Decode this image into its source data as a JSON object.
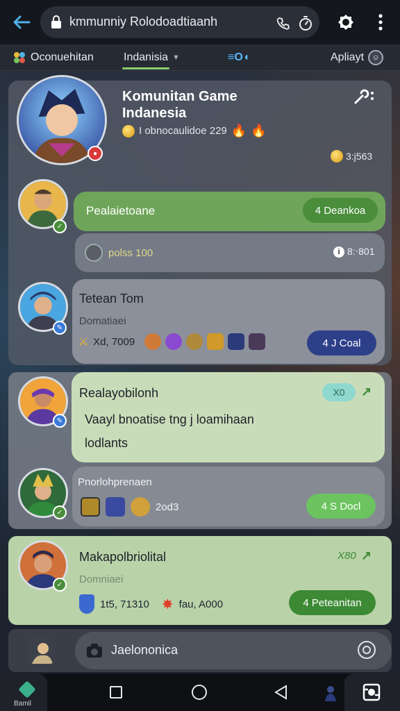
{
  "browser": {
    "url": "kmmunniy Rolodoadtiaanh",
    "icons": [
      "back-arrow-icon",
      "lock-icon",
      "phone-icon",
      "timer-icon",
      "gear-icon",
      "more-vert-icon"
    ]
  },
  "tabs": [
    {
      "label": "Oconuehitan",
      "icon": "community-icon"
    },
    {
      "label": "Indanisia",
      "active": true
    },
    {
      "label": "≡O◖"
    },
    {
      "label": "Apliayt"
    }
  ],
  "community": {
    "title": "Komunitan Game Indanesia",
    "subtitle": "I obnocaulidoe 229",
    "coin_count": "3:j563"
  },
  "posts": [
    {
      "bubble_text": "Pealaietoane",
      "action_label": "4 Deankoa",
      "meta_text": "polss 100",
      "meta_count": "8:‧801"
    },
    {
      "name": "Tetean Tom",
      "sub": "Domatiaei",
      "stat": "Xd, 7009",
      "action_label": "4 J Coal"
    },
    {
      "name": "Realayobilonh",
      "badge": "X0",
      "message_line1": "Vaayl bnoatise tng j loamihaan",
      "message_line2": "lodlants",
      "sub_name": "Pnorlohprenaen",
      "stat": "2od3",
      "action_label": "4 S Docl"
    },
    {
      "name": "Makapolbriolital",
      "badge": "X80",
      "sub": "Domniaei",
      "stat1": "1t5, 71310",
      "stat2": "fau, A000",
      "action_label": "4 Peteanitan"
    }
  ],
  "composer": {
    "placeholder": "Jaelononica"
  },
  "bottom_nav": {
    "home_label": "Bamil"
  },
  "colors": {
    "accent_green": "#6fa55a",
    "navy_button": "#2e3f8a",
    "panel_light_green": "#b9d2a8"
  }
}
